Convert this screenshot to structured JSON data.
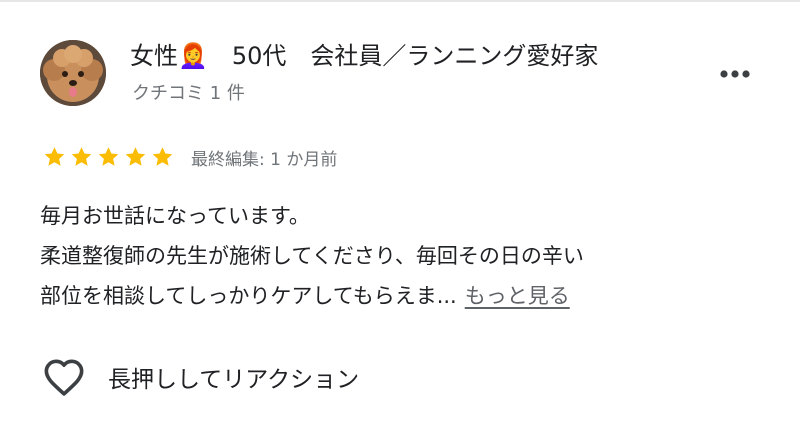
{
  "reviewer": {
    "name": "女性👩‍🦰　50代　会社員／ランニング愛好家",
    "review_count": "クチコミ 1 件"
  },
  "rating": {
    "stars": 5,
    "star_color": "#fbbc04"
  },
  "edited": "最終編集: 1 か月前",
  "review": {
    "lines": [
      "毎月お世話になっています。",
      "柔道整復師の先生が施術してくださり、毎回その日の辛い",
      "部位を相談してしっかりケアしてもらえま..."
    ],
    "read_more": "もっと見る"
  },
  "reaction": {
    "label": "長押ししてリアクション",
    "icon": "heart-outline-icon"
  },
  "menu_icon": "more-vert-icon"
}
